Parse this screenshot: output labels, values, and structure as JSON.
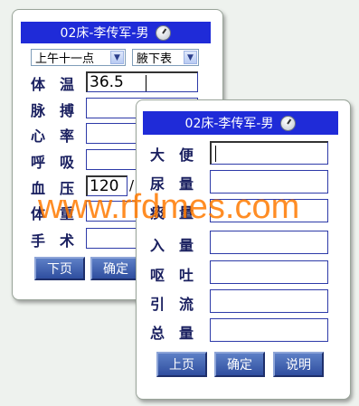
{
  "colors": {
    "titlebar": "#1f2bd8",
    "field_border": "#2d3aa8",
    "label": "#1a2060",
    "button": "#3a5aab",
    "watermark": "#ff7a00"
  },
  "back_panel": {
    "title": "02床-李传军-男",
    "time_select": "上午十一点",
    "site_select": "腋下表",
    "rows": [
      {
        "label": "体　温",
        "value": "36.5"
      },
      {
        "label": "脉　搏",
        "value": ""
      },
      {
        "label": "心　率",
        "value": ""
      },
      {
        "label": "呼　吸",
        "value": ""
      },
      {
        "label": "血　压",
        "value": "120"
      },
      {
        "label": "体　重",
        "value": ""
      },
      {
        "label": "手　术",
        "value": ""
      }
    ],
    "bp_separator": "/",
    "buttons": {
      "next": "下页",
      "confirm": "确定"
    }
  },
  "front_panel": {
    "title": "02床-李传军-男",
    "rows": [
      {
        "label": "大　便",
        "value": ""
      },
      {
        "label": "尿　量",
        "value": ""
      },
      {
        "label": "痰　量",
        "value": ""
      },
      {
        "label": "入　量",
        "value": ""
      },
      {
        "label": "呕　吐",
        "value": ""
      },
      {
        "label": "引　流",
        "value": ""
      },
      {
        "label": "总　量",
        "value": ""
      }
    ],
    "buttons": {
      "prev": "上页",
      "confirm": "确定",
      "help": "说明"
    }
  },
  "watermark": "www.rfdmes.com"
}
